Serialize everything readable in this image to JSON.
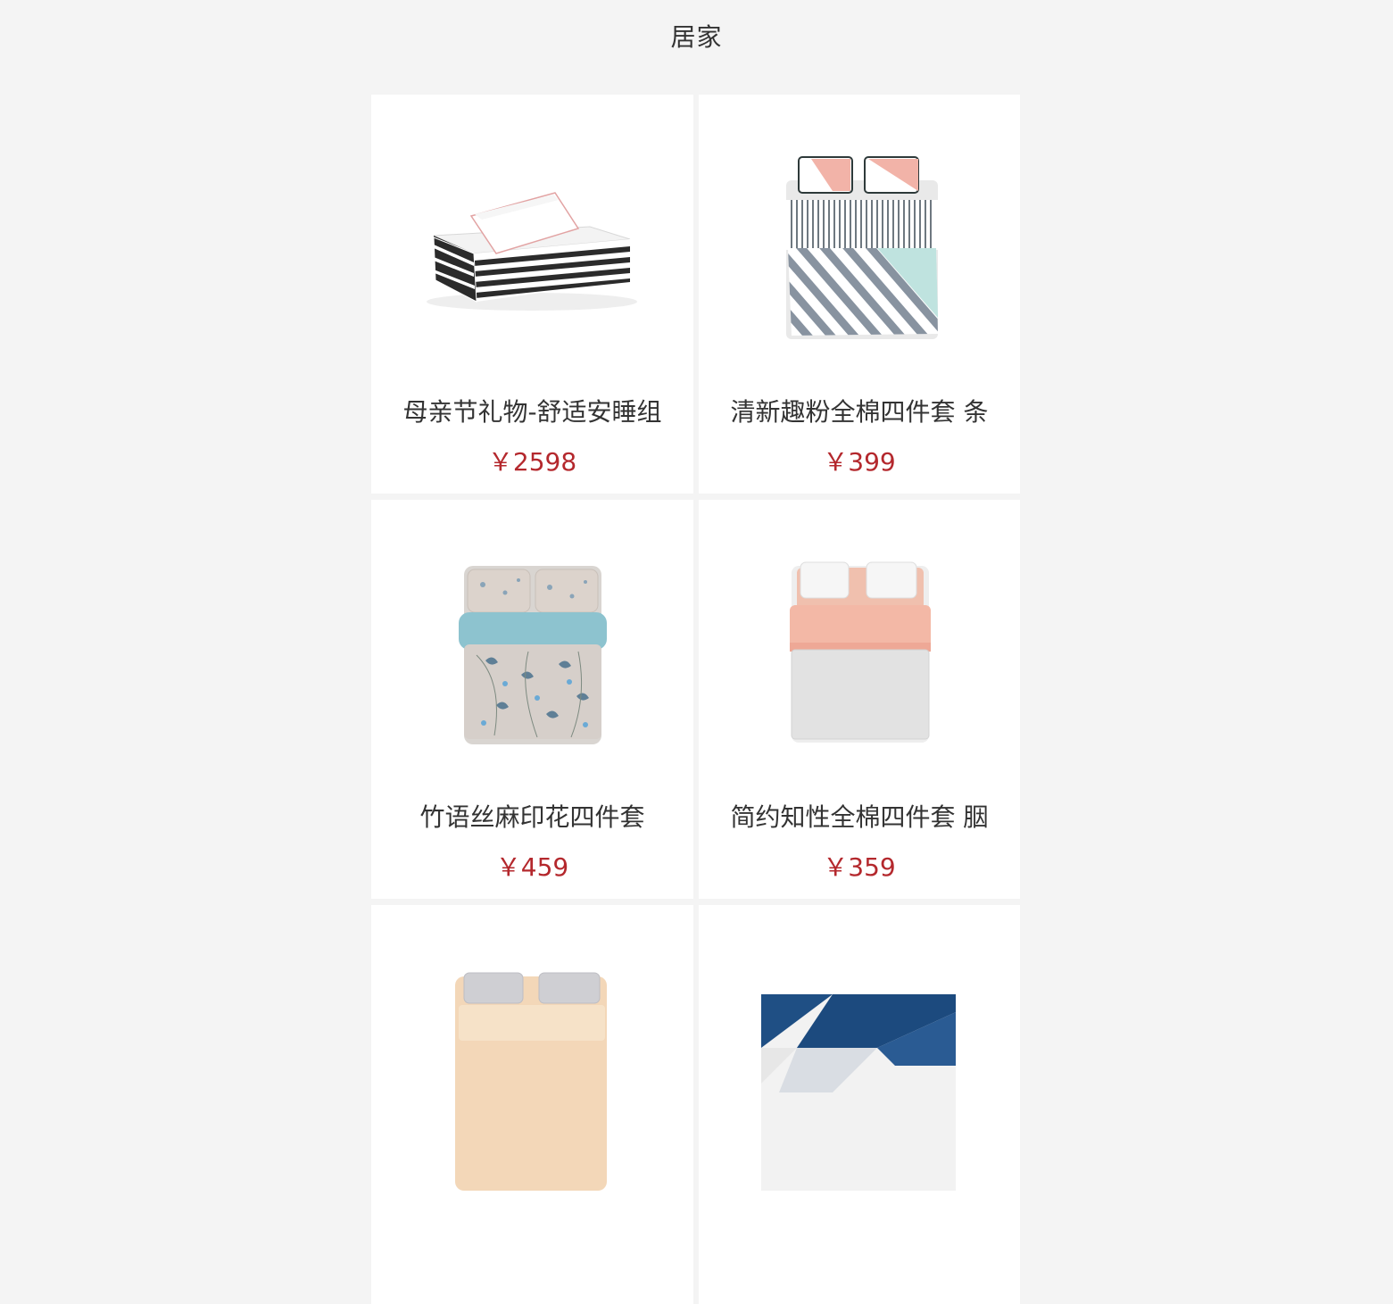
{
  "header": {
    "title": "居家"
  },
  "currency_symbol": "￥",
  "products": [
    {
      "name": "母亲节礼物-舒适安睡组",
      "price": "2598",
      "image": "mattress-with-pillow"
    },
    {
      "name": "清新趣粉全棉四件套 条",
      "price": "399",
      "image": "striped-bedding-set"
    },
    {
      "name": "竹语丝麻印花四件套",
      "price": "459",
      "image": "floral-blue-bedding-set"
    },
    {
      "name": "简约知性全棉四件套 胭",
      "price": "359",
      "image": "pink-grey-bedding-set"
    },
    {
      "name": "",
      "price": "",
      "image": "beige-bedding-set"
    },
    {
      "name": "",
      "price": "",
      "image": "geometric-navy-bedding-set"
    }
  ],
  "colors": {
    "background": "#f4f4f4",
    "card": "#ffffff",
    "price": "#b4282d",
    "text": "#333333"
  }
}
